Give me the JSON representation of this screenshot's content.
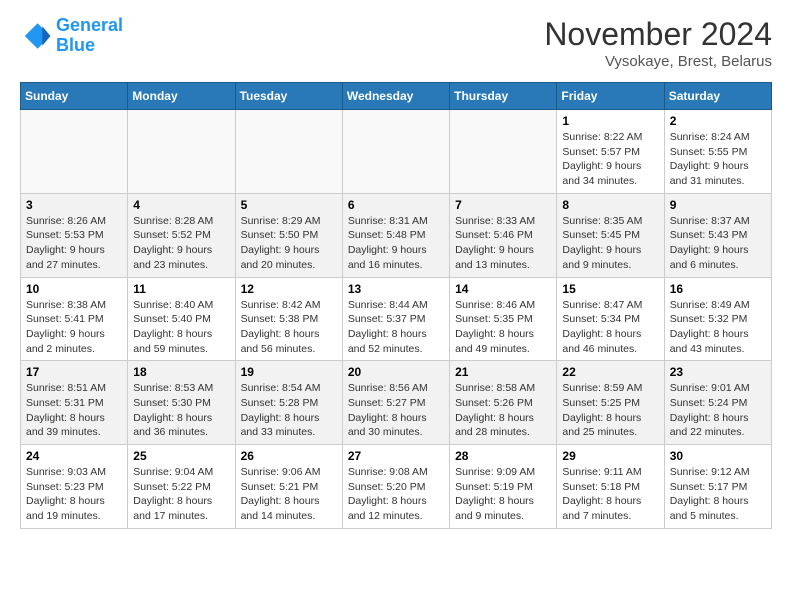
{
  "logo": {
    "text1": "General",
    "text2": "Blue"
  },
  "title": "November 2024",
  "location": "Vysokaye, Brest, Belarus",
  "weekdays": [
    "Sunday",
    "Monday",
    "Tuesday",
    "Wednesday",
    "Thursday",
    "Friday",
    "Saturday"
  ],
  "weeks": [
    [
      {
        "day": "",
        "info": ""
      },
      {
        "day": "",
        "info": ""
      },
      {
        "day": "",
        "info": ""
      },
      {
        "day": "",
        "info": ""
      },
      {
        "day": "",
        "info": ""
      },
      {
        "day": "1",
        "info": "Sunrise: 8:22 AM\nSunset: 5:57 PM\nDaylight: 9 hours and 34 minutes."
      },
      {
        "day": "2",
        "info": "Sunrise: 8:24 AM\nSunset: 5:55 PM\nDaylight: 9 hours and 31 minutes."
      }
    ],
    [
      {
        "day": "3",
        "info": "Sunrise: 8:26 AM\nSunset: 5:53 PM\nDaylight: 9 hours and 27 minutes."
      },
      {
        "day": "4",
        "info": "Sunrise: 8:28 AM\nSunset: 5:52 PM\nDaylight: 9 hours and 23 minutes."
      },
      {
        "day": "5",
        "info": "Sunrise: 8:29 AM\nSunset: 5:50 PM\nDaylight: 9 hours and 20 minutes."
      },
      {
        "day": "6",
        "info": "Sunrise: 8:31 AM\nSunset: 5:48 PM\nDaylight: 9 hours and 16 minutes."
      },
      {
        "day": "7",
        "info": "Sunrise: 8:33 AM\nSunset: 5:46 PM\nDaylight: 9 hours and 13 minutes."
      },
      {
        "day": "8",
        "info": "Sunrise: 8:35 AM\nSunset: 5:45 PM\nDaylight: 9 hours and 9 minutes."
      },
      {
        "day": "9",
        "info": "Sunrise: 8:37 AM\nSunset: 5:43 PM\nDaylight: 9 hours and 6 minutes."
      }
    ],
    [
      {
        "day": "10",
        "info": "Sunrise: 8:38 AM\nSunset: 5:41 PM\nDaylight: 9 hours and 2 minutes."
      },
      {
        "day": "11",
        "info": "Sunrise: 8:40 AM\nSunset: 5:40 PM\nDaylight: 8 hours and 59 minutes."
      },
      {
        "day": "12",
        "info": "Sunrise: 8:42 AM\nSunset: 5:38 PM\nDaylight: 8 hours and 56 minutes."
      },
      {
        "day": "13",
        "info": "Sunrise: 8:44 AM\nSunset: 5:37 PM\nDaylight: 8 hours and 52 minutes."
      },
      {
        "day": "14",
        "info": "Sunrise: 8:46 AM\nSunset: 5:35 PM\nDaylight: 8 hours and 49 minutes."
      },
      {
        "day": "15",
        "info": "Sunrise: 8:47 AM\nSunset: 5:34 PM\nDaylight: 8 hours and 46 minutes."
      },
      {
        "day": "16",
        "info": "Sunrise: 8:49 AM\nSunset: 5:32 PM\nDaylight: 8 hours and 43 minutes."
      }
    ],
    [
      {
        "day": "17",
        "info": "Sunrise: 8:51 AM\nSunset: 5:31 PM\nDaylight: 8 hours and 39 minutes."
      },
      {
        "day": "18",
        "info": "Sunrise: 8:53 AM\nSunset: 5:30 PM\nDaylight: 8 hours and 36 minutes."
      },
      {
        "day": "19",
        "info": "Sunrise: 8:54 AM\nSunset: 5:28 PM\nDaylight: 8 hours and 33 minutes."
      },
      {
        "day": "20",
        "info": "Sunrise: 8:56 AM\nSunset: 5:27 PM\nDaylight: 8 hours and 30 minutes."
      },
      {
        "day": "21",
        "info": "Sunrise: 8:58 AM\nSunset: 5:26 PM\nDaylight: 8 hours and 28 minutes."
      },
      {
        "day": "22",
        "info": "Sunrise: 8:59 AM\nSunset: 5:25 PM\nDaylight: 8 hours and 25 minutes."
      },
      {
        "day": "23",
        "info": "Sunrise: 9:01 AM\nSunset: 5:24 PM\nDaylight: 8 hours and 22 minutes."
      }
    ],
    [
      {
        "day": "24",
        "info": "Sunrise: 9:03 AM\nSunset: 5:23 PM\nDaylight: 8 hours and 19 minutes."
      },
      {
        "day": "25",
        "info": "Sunrise: 9:04 AM\nSunset: 5:22 PM\nDaylight: 8 hours and 17 minutes."
      },
      {
        "day": "26",
        "info": "Sunrise: 9:06 AM\nSunset: 5:21 PM\nDaylight: 8 hours and 14 minutes."
      },
      {
        "day": "27",
        "info": "Sunrise: 9:08 AM\nSunset: 5:20 PM\nDaylight: 8 hours and 12 minutes."
      },
      {
        "day": "28",
        "info": "Sunrise: 9:09 AM\nSunset: 5:19 PM\nDaylight: 8 hours and 9 minutes."
      },
      {
        "day": "29",
        "info": "Sunrise: 9:11 AM\nSunset: 5:18 PM\nDaylight: 8 hours and 7 minutes."
      },
      {
        "day": "30",
        "info": "Sunrise: 9:12 AM\nSunset: 5:17 PM\nDaylight: 8 hours and 5 minutes."
      }
    ]
  ]
}
